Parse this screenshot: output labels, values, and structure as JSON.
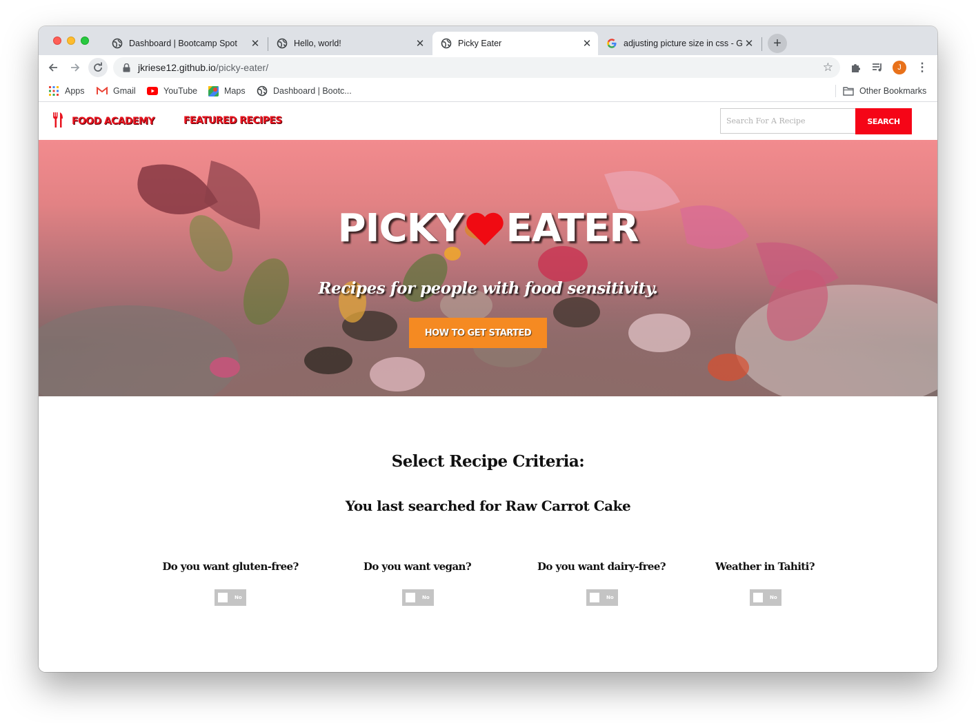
{
  "browser": {
    "tabs": [
      {
        "title": "Dashboard | Bootcamp Spot",
        "favicon": "globe-icon",
        "active": false
      },
      {
        "title": "Hello, world!",
        "favicon": "globe-icon",
        "active": false
      },
      {
        "title": "Picky Eater",
        "favicon": "globe-icon",
        "active": true
      },
      {
        "title": "adjusting picture size in css - G",
        "favicon": "google-icon",
        "active": false
      }
    ],
    "url_host": "jkriese12.github.io",
    "url_path": "/picky-eater/",
    "profile_initial": "J",
    "bookmarks": [
      {
        "label": "Apps",
        "icon": "apps-grid-icon"
      },
      {
        "label": "Gmail",
        "icon": "gmail-icon"
      },
      {
        "label": "YouTube",
        "icon": "youtube-icon"
      },
      {
        "label": "Maps",
        "icon": "maps-icon"
      },
      {
        "label": "Dashboard | Bootc...",
        "icon": "globe-icon"
      }
    ],
    "other_bookmarks": "Other Bookmarks"
  },
  "site": {
    "brand": "Food Academy",
    "nav_link": "Featured Recipes",
    "search_placeholder": "Search For A Recipe",
    "search_button": "Search"
  },
  "hero": {
    "title_left": "PICKY",
    "title_right": "EATER",
    "subtitle": "Recipes for people with food sensitivity.",
    "cta": "How to get started"
  },
  "criteria": {
    "title": "Select Recipe Criteria:",
    "last_search": "You last searched for Raw Carrot Cake",
    "questions": [
      {
        "label": "Do you want gluten-free?",
        "toggle": "No"
      },
      {
        "label": "Do you want vegan?",
        "toggle": "No"
      },
      {
        "label": "Do you want dairy-free?",
        "toggle": "No"
      },
      {
        "label": "Weather in Tahiti?",
        "toggle": "No"
      }
    ]
  },
  "colors": {
    "brand_red": "#e8141f",
    "search_red": "#f50517",
    "cta_orange": "#f58a22",
    "toggle_gray": "#c4c4c4"
  }
}
